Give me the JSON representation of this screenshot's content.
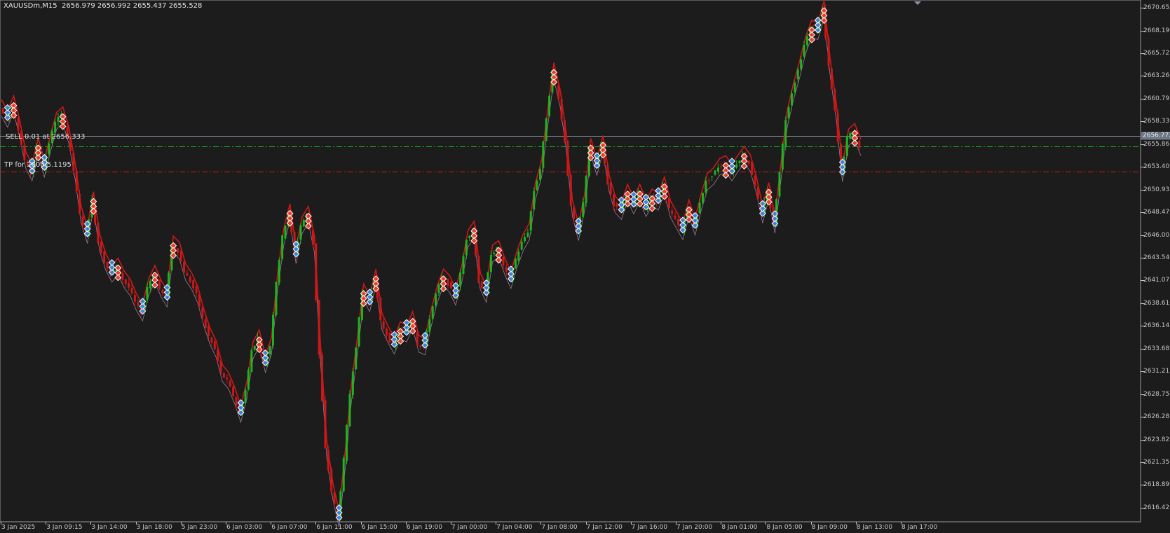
{
  "window": {
    "title": "XAUUSDm,M15  2656.979 2656.992 2655.437 2655.528"
  },
  "colors": {
    "background": "#1c1c1c",
    "axis_text": "#c8c8c8",
    "bull": "#1fb31f",
    "bear": "#cc1818",
    "marker_sell": "#e8412b",
    "marker_buy": "#3a86d4",
    "entry_line": "#18b018",
    "tp_line": "#d01818",
    "current_line": "#8a96a8"
  },
  "trade_labels": {
    "entry": "SELL 0.01 at 2656.333",
    "tp": "TP for 2000.5.1195"
  },
  "lines": {
    "current_price": 2656.773,
    "entry_price": 2655.623,
    "tp_price": 2652.86
  },
  "price_axis": {
    "ticks": [
      "2670.655",
      "2668.190",
      "2665.725",
      "2663.260",
      "2660.795",
      "2658.330",
      "2655.865",
      "2653.400",
      "2650.935",
      "2648.470",
      "2646.005",
      "2643.540",
      "2641.075",
      "2638.610",
      "2636.145",
      "2633.680",
      "2631.215",
      "2628.750",
      "2626.285",
      "2623.820",
      "2621.355",
      "2618.890",
      "2616.425"
    ],
    "current_tag": "2656.773"
  },
  "time_axis": {
    "ticks": [
      "3 Jan 2025",
      "3 Jan 09:15",
      "3 Jan 14:00",
      "3 Jan 18:00",
      "5 Jan 23:00",
      "6 Jan 03:00",
      "6 Jan 07:00",
      "6 Jan 11:00",
      "6 Jan 15:00",
      "6 Jan 19:00",
      "7 Jan 00:00",
      "7 Jan 04:00",
      "7 Jan 08:00",
      "7 Jan 12:00",
      "7 Jan 16:00",
      "7 Jan 20:00",
      "8 Jan 01:00",
      "8 Jan 05:00",
      "8 Jan 09:00",
      "8 Jan 13:00",
      "8 Jan 17:00"
    ]
  },
  "chart_data": {
    "type": "line",
    "symbol": "XAUUSDm",
    "timeframe": "M15",
    "ylim": [
      2614.9,
      2671.5
    ],
    "x_categories": [
      "3 Jan 2025",
      "3 Jan 09:15",
      "3 Jan 14:00",
      "3 Jan 18:00",
      "5 Jan 23:00",
      "6 Jan 03:00",
      "6 Jan 07:00",
      "6 Jan 11:00",
      "6 Jan 15:00",
      "6 Jan 19:00",
      "7 Jan 00:00",
      "7 Jan 04:00",
      "7 Jan 08:00",
      "7 Jan 12:00",
      "7 Jan 16:00",
      "7 Jan 20:00",
      "8 Jan 01:00",
      "8 Jan 05:00",
      "8 Jan 09:00",
      "8 Jan 13:00",
      "8 Jan 17:00"
    ],
    "series": [
      {
        "values": [
          [
            0,
            2659.8
          ],
          [
            1,
            2658.6
          ],
          [
            2,
            2660.2
          ],
          [
            3,
            2657.5
          ],
          [
            4,
            2654.1
          ],
          [
            5,
            2652.8
          ],
          [
            6,
            2655.6
          ],
          [
            7,
            2653.2
          ],
          [
            8,
            2656.0
          ],
          [
            9,
            2658.4
          ],
          [
            10,
            2659.0
          ],
          [
            11,
            2656.8
          ],
          [
            12,
            2653.0
          ],
          [
            13,
            2648.2
          ],
          [
            14,
            2646.0
          ],
          [
            15,
            2649.8
          ],
          [
            16,
            2645.2
          ],
          [
            17,
            2643.1
          ],
          [
            18,
            2641.8
          ],
          [
            19,
            2642.6
          ],
          [
            20,
            2641.2
          ],
          [
            21,
            2640.3
          ],
          [
            22,
            2638.7
          ],
          [
            23,
            2637.6
          ],
          [
            24,
            2640.4
          ],
          [
            25,
            2641.8
          ],
          [
            26,
            2640.2
          ],
          [
            27,
            2639.1
          ],
          [
            28,
            2645.0
          ],
          [
            29,
            2644.3
          ],
          [
            30,
            2642.0
          ],
          [
            31,
            2641.0
          ],
          [
            32,
            2639.5
          ],
          [
            33,
            2637.0
          ],
          [
            34,
            2635.0
          ],
          [
            35,
            2633.6
          ],
          [
            36,
            2631.0
          ],
          [
            37,
            2630.2
          ],
          [
            38,
            2628.6
          ],
          [
            39,
            2626.6
          ],
          [
            40,
            2629.2
          ],
          [
            41,
            2633.5
          ],
          [
            42,
            2634.8
          ],
          [
            43,
            2632.0
          ],
          [
            44,
            2634.0
          ],
          [
            45,
            2641.0
          ],
          [
            46,
            2645.8
          ],
          [
            47,
            2648.5
          ],
          [
            48,
            2643.8
          ],
          [
            49,
            2647.1
          ],
          [
            50,
            2648.2
          ],
          [
            51,
            2645.0
          ],
          [
            52,
            2633.0
          ],
          [
            53,
            2622.8
          ],
          [
            54,
            2618.2
          ],
          [
            55,
            2615.2
          ],
          [
            56,
            2621.6
          ],
          [
            57,
            2628.8
          ],
          [
            58,
            2634.0
          ],
          [
            59,
            2639.8
          ],
          [
            60,
            2638.6
          ],
          [
            61,
            2641.4
          ],
          [
            62,
            2636.6
          ],
          [
            63,
            2635.2
          ],
          [
            64,
            2634.0
          ],
          [
            65,
            2635.7
          ],
          [
            66,
            2635.3
          ],
          [
            67,
            2636.8
          ],
          [
            68,
            2634.2
          ],
          [
            69,
            2633.9
          ],
          [
            70,
            2637.0
          ],
          [
            71,
            2639.6
          ],
          [
            72,
            2641.4
          ],
          [
            73,
            2640.7
          ],
          [
            74,
            2639.3
          ],
          [
            75,
            2641.8
          ],
          [
            76,
            2645.6
          ],
          [
            77,
            2646.6
          ],
          [
            78,
            2641.0
          ],
          [
            79,
            2639.6
          ],
          [
            80,
            2644.0
          ],
          [
            81,
            2644.5
          ],
          [
            82,
            2642.6
          ],
          [
            83,
            2641.1
          ],
          [
            84,
            2643.4
          ],
          [
            85,
            2645.2
          ],
          [
            86,
            2646.4
          ],
          [
            87,
            2650.8
          ],
          [
            88,
            2653.2
          ],
          [
            89,
            2658.8
          ],
          [
            90,
            2663.8
          ],
          [
            91,
            2660.9
          ],
          [
            92,
            2656.2
          ],
          [
            93,
            2649.0
          ],
          [
            94,
            2646.3
          ],
          [
            95,
            2649.5
          ],
          [
            96,
            2655.6
          ],
          [
            97,
            2653.4
          ],
          [
            98,
            2655.9
          ],
          [
            99,
            2651.6
          ],
          [
            100,
            2649.3
          ],
          [
            101,
            2648.6
          ],
          [
            102,
            2650.6
          ],
          [
            103,
            2649.2
          ],
          [
            104,
            2650.6
          ],
          [
            105,
            2648.9
          ],
          [
            106,
            2650.1
          ],
          [
            107,
            2649.6
          ],
          [
            108,
            2651.4
          ],
          [
            109,
            2648.8
          ],
          [
            110,
            2647.6
          ],
          [
            111,
            2646.4
          ],
          [
            112,
            2648.9
          ],
          [
            113,
            2646.9
          ],
          [
            114,
            2649.6
          ],
          [
            115,
            2651.8
          ],
          [
            116,
            2652.4
          ],
          [
            117,
            2653.4
          ],
          [
            118,
            2653.7
          ],
          [
            119,
            2652.8
          ],
          [
            120,
            2653.8
          ],
          [
            121,
            2654.7
          ],
          [
            122,
            2653.8
          ],
          [
            123,
            2651.4
          ],
          [
            124,
            2648.2
          ],
          [
            125,
            2650.8
          ],
          [
            126,
            2647.1
          ],
          [
            127,
            2653.0
          ],
          [
            128,
            2658.6
          ],
          [
            129,
            2661.5
          ],
          [
            130,
            2663.9
          ],
          [
            131,
            2666.6
          ],
          [
            132,
            2668.4
          ],
          [
            133,
            2668.1
          ],
          [
            134,
            2670.5
          ],
          [
            135,
            2664.2
          ],
          [
            136,
            2659.4
          ],
          [
            137,
            2652.7
          ],
          [
            138,
            2656.6
          ],
          [
            139,
            2657.2
          ],
          [
            140,
            2655.5
          ]
        ]
      }
    ]
  }
}
